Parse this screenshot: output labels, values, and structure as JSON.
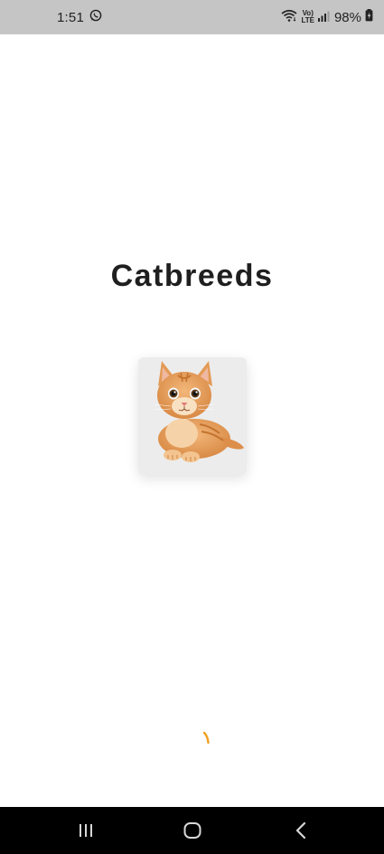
{
  "status_bar": {
    "time": "1:51",
    "notification_icons": [
      "whatsapp-icon"
    ],
    "volte_top": "Vo)",
    "volte_bottom": "LTE",
    "battery_percent": "98%"
  },
  "app": {
    "title": "Catbreeds",
    "image_icon": "cat-image",
    "loading_indicator_color": "#f0a020"
  },
  "nav_bar": {
    "buttons": [
      "recent-apps-icon",
      "home-icon",
      "back-icon"
    ]
  },
  "colors": {
    "status_bar_bg": "#c5c5c5",
    "background": "#ffffff",
    "title_text": "#1f1f1f",
    "nav_bar_bg": "#000000",
    "accent": "#f0a020"
  }
}
